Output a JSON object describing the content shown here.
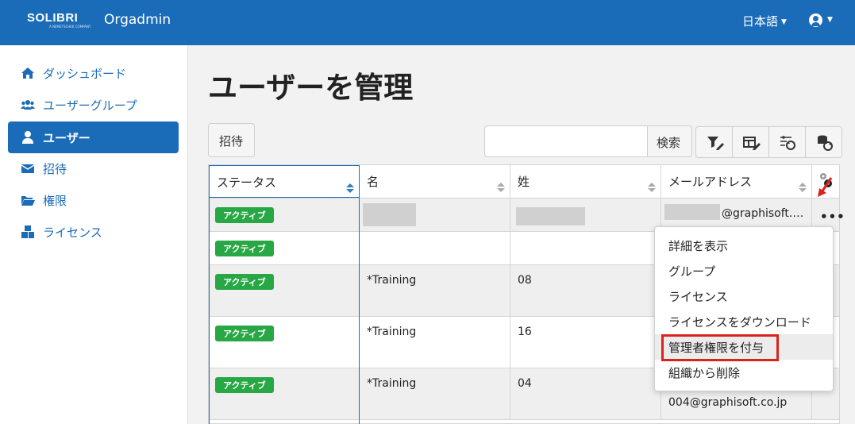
{
  "header": {
    "logo": "SOLIBRI",
    "logo_sub": "A NEMETSCHEK COMPANY",
    "app_name": "Orgadmin",
    "language": "日本語",
    "user_icon": "user-circle-icon",
    "background": "#1a6cb8"
  },
  "sidebar": {
    "items": [
      {
        "label": "ダッシュボード",
        "icon": "home-icon"
      },
      {
        "label": "ユーザーグループ",
        "icon": "users-icon"
      },
      {
        "label": "ユーザー",
        "icon": "user-icon",
        "active": true
      },
      {
        "label": "招待",
        "icon": "envelope-icon"
      },
      {
        "label": "権限",
        "icon": "folder-open-icon"
      },
      {
        "label": "ライセンス",
        "icon": "boxes-icon"
      }
    ]
  },
  "main": {
    "title": "ユーザーを管理",
    "invite_button": "招待",
    "search": {
      "placeholder": "",
      "value": "",
      "button": "検索"
    },
    "toolbar_icons": [
      "filter-edit-icon",
      "column-edit-icon",
      "filter-reset-icon",
      "database-refresh-icon"
    ]
  },
  "table": {
    "columns": [
      "ステータス",
      "名",
      "姓",
      "メールアドレス"
    ],
    "settings_icon": "gears-icon",
    "rows": [
      {
        "status": "アクティブ",
        "first": "",
        "last": "",
        "email": "@graphisoft.…"
      },
      {
        "status": "アクティブ",
        "first": "",
        "last": "",
        "email": ""
      },
      {
        "status": "アクティブ",
        "first": "*Training",
        "last": "08",
        "email": ""
      },
      {
        "status": "アクティブ",
        "first": "*Training",
        "last": "16",
        "email": ""
      },
      {
        "status": "アクティブ",
        "first": "*Training",
        "last": "04",
        "email": "004@graphisoft.co.jp"
      }
    ],
    "actions_label": "•••"
  },
  "menu": {
    "items": [
      "詳細を表示",
      "グループ",
      "ライセンス",
      "ライセンスをダウンロード",
      "管理者権限を付与",
      "組織から削除"
    ],
    "highlighted_index": 4
  },
  "colors": {
    "accent": "#1a6cb8",
    "active_badge": "#28a745",
    "highlight": "#d9231b"
  }
}
